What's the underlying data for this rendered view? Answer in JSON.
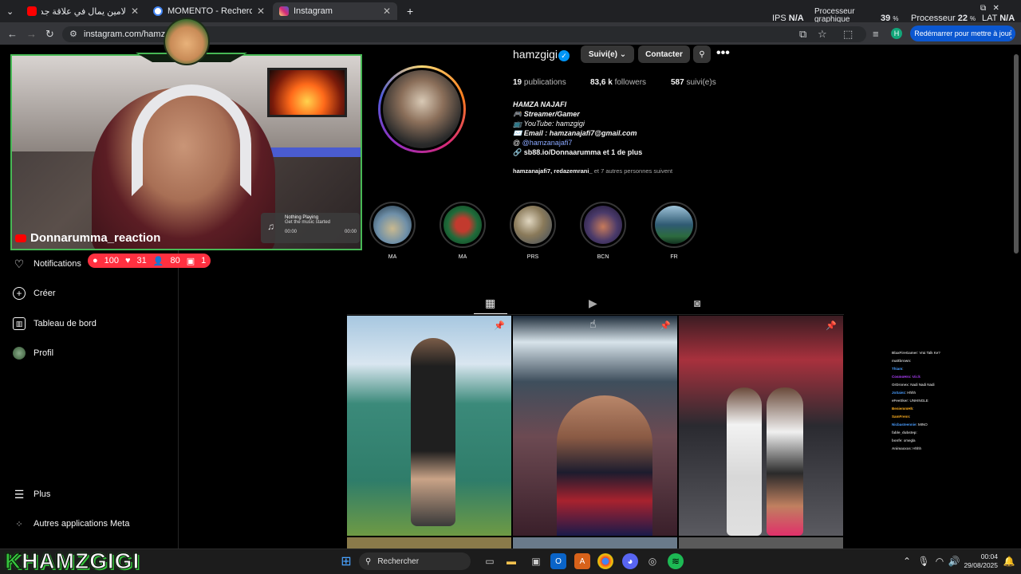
{
  "browser": {
    "tabs": [
      {
        "title": "لامين يمال في علاقة جديدة ! الهد",
        "favicon_color": "#ff0000",
        "active": false
      },
      {
        "title": "MOMENTO - Recherche Google",
        "favicon_color": "#4285f4",
        "active": false
      },
      {
        "title": "Instagram",
        "favicon_color": "#d62976",
        "active": true
      }
    ],
    "new_tab": "+",
    "url": "instagram.com/hamzgigi/",
    "profile_initial": "H",
    "restart_button": "Redémarrer pour mettre à jour"
  },
  "perf_overlay": {
    "ips_label": "IPS",
    "ips_value": "N/A",
    "gpu_label1": "Processeur",
    "gpu_label2": "graphique",
    "gpu_value": "39",
    "cpu_label": "Processeur",
    "cpu_value": "22",
    "lat_label": "LAT",
    "lat_value": "N/A",
    "percent": "%"
  },
  "stream": {
    "channel_label": "Donnarumma_reaction",
    "now_playing_title": "Nothing Playing",
    "now_playing_sub": "Get the music started",
    "time_start": "00:00",
    "time_end": "00:00",
    "brand": "HAMZGIGI",
    "brand_first": "K"
  },
  "sidebar": {
    "notifications": "Notifications",
    "badge": {
      "comments": "100",
      "likes": "31",
      "followers": "80",
      "mentions": "1"
    },
    "create": "Créer",
    "dashboard": "Tableau de bord",
    "profile": "Profil",
    "more": "Plus",
    "meta_apps": "Autres applications Meta"
  },
  "profile": {
    "username": "hamzgigi",
    "following_button": "Suivi(e)",
    "contact_button": "Contacter",
    "posts_count": "19",
    "posts_label": "publications",
    "followers_count": "83,6 k",
    "followers_label": "followers",
    "following_count": "587",
    "following_label": "suivi(e)s",
    "bio_name": "HAMZA NAJAFI",
    "bio_lines": [
      "🎮 Streamer/Gamer",
      "📺 YouTube: hamzgigi",
      "✉️ Email : hamzanajafi7@gmail.com"
    ],
    "threads": "@hamzanajafi7",
    "link": "sb88.io/Donnaarumma et 1 de plus",
    "followed_by_names": "hamzanajafi7, redazemrani_",
    "followed_by_rest": "et 7 autres personnes suivent"
  },
  "highlights": [
    {
      "label": "MA",
      "color": "#6e8fa8"
    },
    {
      "label": "MA",
      "color": "#1f6b3a"
    },
    {
      "label": "PRS",
      "color": "#8a7a5a"
    },
    {
      "label": "BCN",
      "color": "#4a3a6a"
    },
    {
      "label": "FR",
      "color": "#2f5a72"
    }
  ],
  "chat": [
    {
      "user": "BlaxFireGamer",
      "msg": "Vrai Talk Ke?",
      "color": "#c0c0c0"
    },
    {
      "user": "mattbrown",
      "msg": "",
      "color": "#c0c0c0"
    },
    {
      "user": "Thiam",
      "msg": "",
      "color": "#4a9eff"
    },
    {
      "user": "CosmoHro",
      "msg": "Miidk",
      "color": "#b040ff"
    },
    {
      "user": "OrDronex",
      "msg": "Nadi Nadi Nadi",
      "color": "#c0c0c0"
    },
    {
      "user": "JoSaiez",
      "msg": "Hhhh",
      "color": "#4a9eff"
    },
    {
      "user": "eFeeSker",
      "msg": "UNHINGLE",
      "color": "#c0c0c0"
    },
    {
      "user": "BeniemmHh",
      "msg": "",
      "color": "#ffb020"
    },
    {
      "user": "SamFrenn",
      "msg": "",
      "color": "#ffb020"
    },
    {
      "user": "Nicbasteennie",
      "msg": "MINO",
      "color": "#4a9eff"
    },
    {
      "user": "fable_dubstep",
      "msg": "",
      "color": "#c0c0c0"
    },
    {
      "user": "bonfe",
      "msg": "omegla",
      "color": "#c0c0c0"
    },
    {
      "user": "Animaxxxs",
      "msg": "Hhhh",
      "color": "#c0c0c0"
    }
  ],
  "taskbar": {
    "search": "Rechercher",
    "time": "00:04",
    "date": "29/08/2025"
  }
}
